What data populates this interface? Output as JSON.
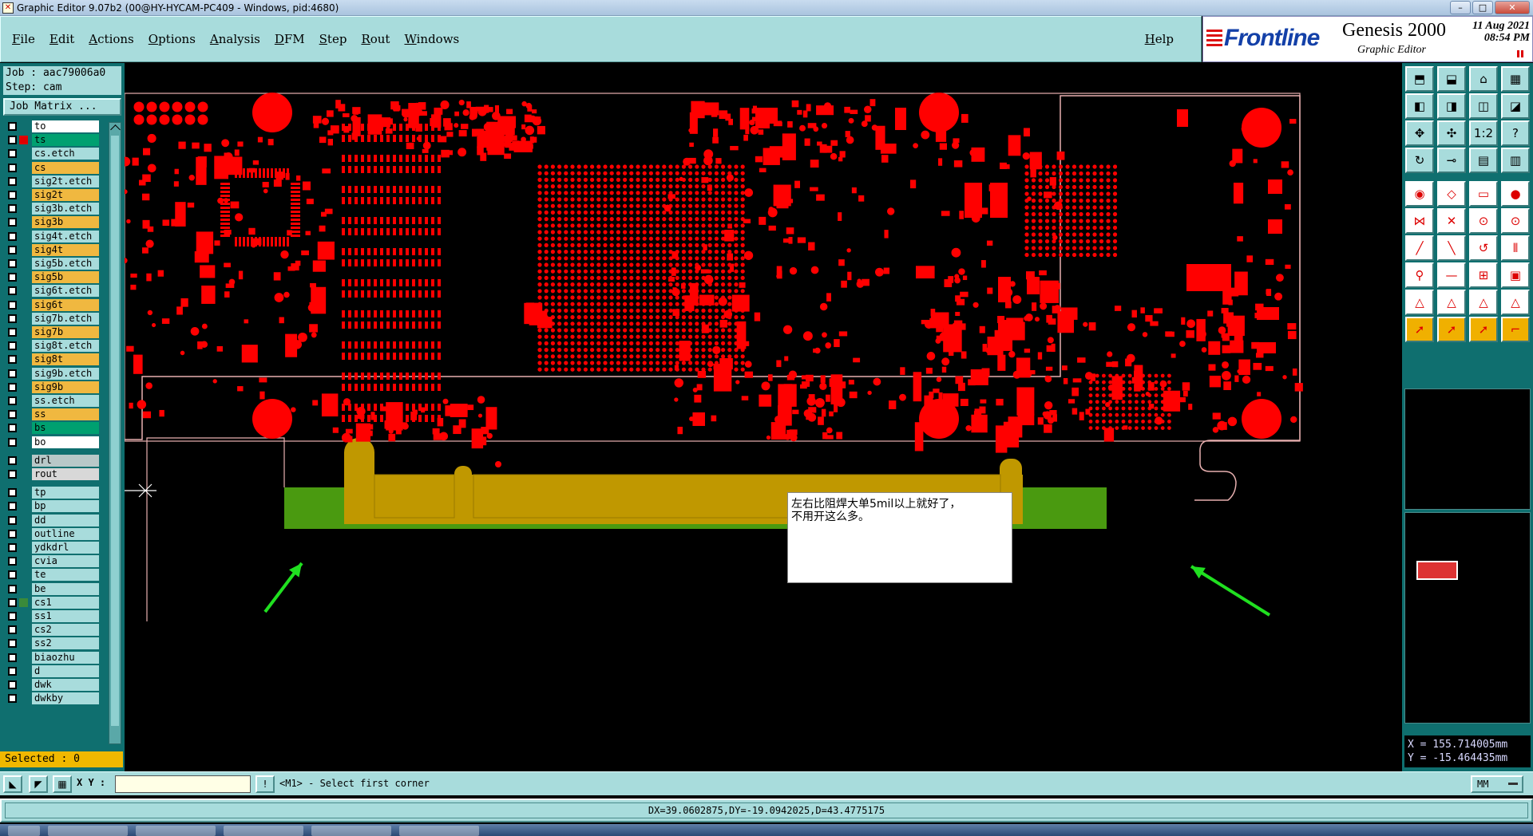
{
  "window": {
    "title": "Graphic Editor 9.07b2 (00@HY-HYCAM-PC409 - Windows, pid:4680)",
    "controls": [
      "minimize",
      "maximize",
      "close"
    ]
  },
  "menubar": {
    "items": [
      "File",
      "Edit",
      "Actions",
      "Options",
      "Analysis",
      "DFM",
      "Step",
      "Rout",
      "Windows"
    ],
    "help": "Help"
  },
  "brand": {
    "logo": "Frontline",
    "product": "Genesis 2000",
    "subtitle": "Graphic Editor",
    "date": "11 Aug 2021",
    "time": "08:54 PM"
  },
  "left_panel": {
    "job": "Job : aac79006a0",
    "step": "Step: cam",
    "job_matrix": "Job Matrix ...",
    "selected": "Selected : 0",
    "layers": [
      {
        "name": "to",
        "color": "#ffffff",
        "mark": true
      },
      {
        "name": "ts",
        "color": "#00a070",
        "active": true
      },
      {
        "name": "cs.etch",
        "color": "#a8dcdc"
      },
      {
        "name": "cs",
        "color": "#f0b840"
      },
      {
        "name": "sig2t.etch",
        "color": "#a8dcdc"
      },
      {
        "name": "sig2t",
        "color": "#f0b840"
      },
      {
        "name": "sig3b.etch",
        "color": "#a8dcdc"
      },
      {
        "name": "sig3b",
        "color": "#f0b840"
      },
      {
        "name": "sig4t.etch",
        "color": "#a8dcdc"
      },
      {
        "name": "sig4t",
        "color": "#f0b840"
      },
      {
        "name": "sig5b.etch",
        "color": "#a8dcdc"
      },
      {
        "name": "sig5b",
        "color": "#f0b840"
      },
      {
        "name": "sig6t.etch",
        "color": "#a8dcdc"
      },
      {
        "name": "sig6t",
        "color": "#f0b840"
      },
      {
        "name": "sig7b.etch",
        "color": "#a8dcdc"
      },
      {
        "name": "sig7b",
        "color": "#f0b840"
      },
      {
        "name": "sig8t.etch",
        "color": "#a8dcdc"
      },
      {
        "name": "sig8t",
        "color": "#f0b840"
      },
      {
        "name": "sig9b.etch",
        "color": "#a8dcdc"
      },
      {
        "name": "sig9b",
        "color": "#f0b840"
      },
      {
        "name": "ss.etch",
        "color": "#a8dcdc"
      },
      {
        "name": "ss",
        "color": "#f0b840"
      },
      {
        "name": "bs",
        "color": "#00a070"
      },
      {
        "name": "bo",
        "color": "#ffffff",
        "mark": true
      },
      {
        "name": "drl",
        "color": "#b8c8c8"
      },
      {
        "name": "rout",
        "color": "#d8d8d8"
      },
      {
        "name": "tp",
        "color": "#a8dcdc"
      },
      {
        "name": "bp",
        "color": "#a8dcdc"
      },
      {
        "name": "dd",
        "color": "#a8dcdc",
        "mark": true
      },
      {
        "name": "outline",
        "color": "#a8dcdc"
      },
      {
        "name": "ydkdrl",
        "color": "#a8dcdc"
      },
      {
        "name": "cvia",
        "color": "#a8dcdc"
      },
      {
        "name": "te",
        "color": "#a8dcdc"
      },
      {
        "name": "be",
        "color": "#a8dcdc"
      },
      {
        "name": "cs1",
        "color": "#a8dcdc",
        "affected": true
      },
      {
        "name": "ss1",
        "color": "#a8dcdc"
      },
      {
        "name": "cs2",
        "color": "#a8dcdc"
      },
      {
        "name": "ss2",
        "color": "#a8dcdc"
      },
      {
        "name": "biaozhu",
        "color": "#a8dcdc"
      },
      {
        "name": "d",
        "color": "#a8dcdc"
      },
      {
        "name": "dwk",
        "color": "#a8dcdc"
      },
      {
        "name": "dwkby",
        "color": "#a8dcdc"
      }
    ]
  },
  "canvas": {
    "note": "左右比阻焊大单5mil以上就好了，\n不用开这么多。",
    "colors": {
      "pads": "#ff0000",
      "gold_finger": "#c09800",
      "soldermask_opening": "#4a9a10",
      "outline": "#e8b0b0",
      "arrows": "#20e020"
    }
  },
  "toolbox": {
    "coord_x": "X = 155.714005mm",
    "coord_y": "Y = -15.464435mm",
    "icons": [
      "open-icon",
      "save-icon",
      "home-icon",
      "layout-icon",
      "step-in-icon",
      "step-out-icon",
      "zoom-toggle-icon",
      "flip-icon",
      "zoom-home-icon",
      "pan-icon",
      "ratio-icon",
      "help-icon",
      "snap-icon",
      "measure-line-icon",
      "layer-a-icon",
      "layer-b-icon",
      "record-icon",
      "edit-shape-icon",
      "ruler-icon",
      "pad-icon",
      "connect-icon",
      "cross-icon",
      "node-a-icon",
      "node-b-icon",
      "line-a-icon",
      "line-b-icon",
      "arc-icon",
      "parallel-icon",
      "attach-icon",
      "minus-icon",
      "align-icon",
      "copy-icon",
      "triangle-a-icon",
      "triangle-b-icon",
      "triangle-c-icon",
      "triangle-d-icon",
      "select-arrow-icon",
      "select-box-icon",
      "select-net-icon",
      "route-icon"
    ]
  },
  "command": {
    "xy_label": "X Y :",
    "xy_value": "",
    "prompt": "<M1> - Select first corner",
    "units": "MM"
  },
  "status": {
    "text": "DX=39.0602875,DY=-19.0942025,D=43.4775175"
  }
}
